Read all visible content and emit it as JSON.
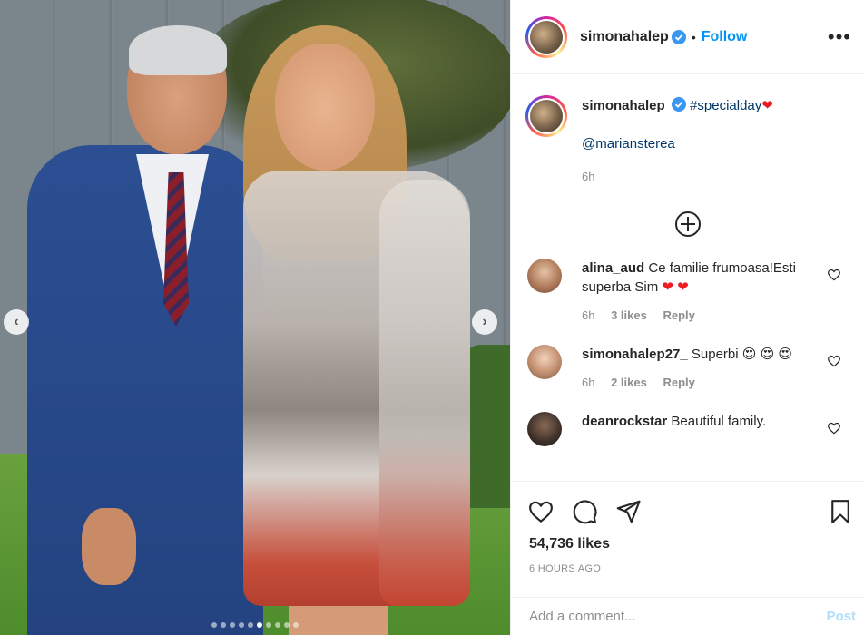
{
  "post": {
    "username": "simonahalep",
    "follow_label": "Follow",
    "bullet": "•",
    "more_label": "•••"
  },
  "caption": {
    "username": "simonahalep",
    "hashtag": "#specialday",
    "heart": "❤",
    "mention": "@mariansterea",
    "time": "6h"
  },
  "comments": [
    {
      "username": "alina_aud",
      "text": "Ce familie frumoasa!Esti superba Sim",
      "emoji": "❤ ❤",
      "time": "6h",
      "likes": "3 likes",
      "reply": "Reply"
    },
    {
      "username": "simonahalep27_",
      "text": "Superbi",
      "emoji": "😍 😍 😍",
      "time": "6h",
      "likes": "2 likes",
      "reply": "Reply"
    },
    {
      "username": "deanrockstar",
      "text": "Beautiful family."
    }
  ],
  "actions": {
    "likes": "54,736 likes",
    "time_ago": "6 HOURS AGO"
  },
  "composer": {
    "placeholder": "Add a comment...",
    "post_label": "Post"
  },
  "carousel": {
    "prev_icon": "‹",
    "next_icon": "›",
    "slide_count": 10,
    "active_index": 5
  },
  "colors": {
    "accent": "#0095f6",
    "heart": "#ed1c24",
    "muted": "#8e8e8e"
  }
}
